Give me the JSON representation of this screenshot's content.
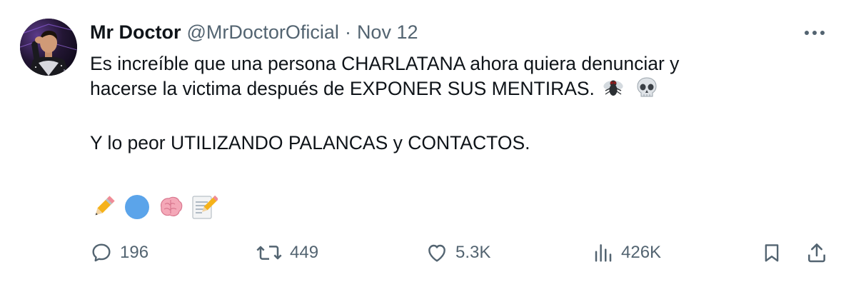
{
  "author": {
    "name": "Mr Doctor",
    "handle": "@MrDoctorOficial",
    "separator": "·",
    "date": "Nov 12"
  },
  "tweet": {
    "line1": "Es increíble que una persona CHARLATANA ahora quiera denunciar y",
    "line2": "hacerse la victima después de EXPONER SUS MENTIRAS.",
    "line3": "Y lo peor UTILIZANDO PALANCAS y CONTACTOS.",
    "inline_emojis": [
      "fly-icon",
      "skull-icon"
    ],
    "emoji_row": [
      "pencil-icon",
      "blue-circle-icon",
      "brain-icon",
      "memo-icon"
    ]
  },
  "actions": {
    "replies": "196",
    "retweets": "449",
    "likes": "5.3K",
    "views": "426K"
  },
  "colors": {
    "text": "#0f1419",
    "muted": "#536471",
    "background": "#ffffff"
  }
}
